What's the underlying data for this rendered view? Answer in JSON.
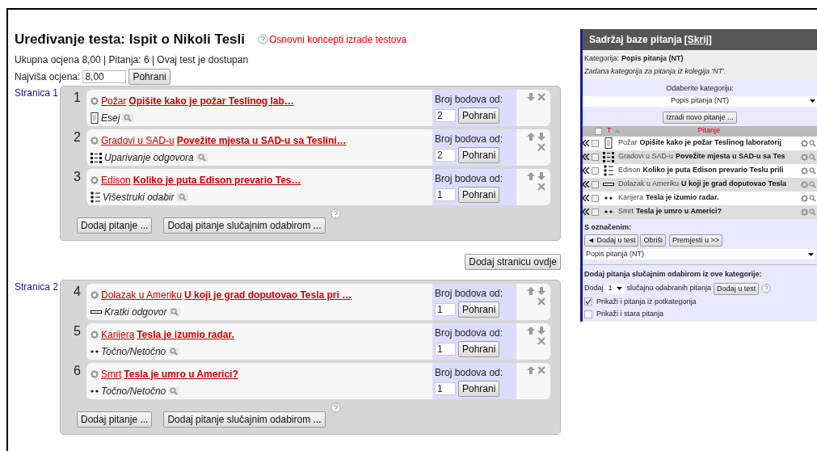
{
  "title": "Uređivanje testa: Ispit o Nikoli Tesli",
  "help_link": "Osnovni koncepti izrade testova",
  "summary": "Ukupna ocjena 8,00 | Pitanja: 6 | Ovaj test je dostupan",
  "max_grade": {
    "label": "Najviša ocjena:",
    "value": "8,00",
    "button": "Pohrani"
  },
  "pages": [
    {
      "label": "Stranica 1",
      "questions": [
        {
          "number": "1",
          "kind": "essay",
          "category": "Požar",
          "text": "Opišite kako je požar Teslinog lab…",
          "type_label": "Esej",
          "points_label": "Broj bodova od:",
          "points": "2",
          "save": "Pohrani",
          "can_move_up": false,
          "can_move_down": true
        },
        {
          "number": "2",
          "kind": "matching",
          "category": "Gradovi u SAD-u",
          "text": "Povežite mjesta u SAD-u sa Teslini…",
          "type_label": "Uparivanje odgovora",
          "points_label": "Broj bodova od:",
          "points": "2",
          "save": "Pohrani",
          "can_move_up": true,
          "can_move_down": true
        },
        {
          "number": "3",
          "kind": "multichoice",
          "category": "Edison",
          "text": "Koliko je puta Edison prevario Tes…",
          "type_label": "Višestruki odabir",
          "points_label": "Broj bodova od:",
          "points": "1",
          "save": "Pohrani",
          "can_move_up": true,
          "can_move_down": true
        }
      ],
      "add_question": "Dodaj pitanje ...",
      "add_random": "Dodaj pitanje slučajnim odabirom ..."
    },
    {
      "label": "Stranica 2",
      "questions": [
        {
          "number": "4",
          "kind": "shortanswer",
          "category": "Dolazak u Ameriku",
          "text": "U koji je grad doputovao Tesla pri …",
          "type_label": "Kratki odgovor",
          "points_label": "Broj bodova od:",
          "points": "1",
          "save": "Pohrani",
          "can_move_up": true,
          "can_move_down": true
        },
        {
          "number": "5",
          "kind": "truefalse",
          "category": "Karijera",
          "text": "Tesla je izumio radar.",
          "type_label": "Točno/Netočno",
          "points_label": "Broj bodova od:",
          "points": "1",
          "save": "Pohrani",
          "can_move_up": true,
          "can_move_down": true
        },
        {
          "number": "6",
          "kind": "truefalse",
          "category": "Smrt",
          "text": "Tesla je umro u Americi?",
          "type_label": "Točno/Netočno",
          "points_label": "Broj bodova od:",
          "points": "1",
          "save": "Pohrani",
          "can_move_up": true,
          "can_move_down": false
        }
      ],
      "add_question": "Dodaj pitanje ...",
      "add_random": "Dodaj pitanje slučajnim odabirom ..."
    }
  ],
  "add_page_button": "Dodaj stranicu ovdje",
  "bank": {
    "title": "Sadržaj baze pitanja",
    "hide_link": "[Skrij]",
    "category_label": "Kategorija:",
    "category": "Popis pitanja (NT)",
    "category_note": "Zadana kategorija za pitanja iz kolegija 'NT'.",
    "choose_label": "Odaberite kategoriju:",
    "choose_value": "Popis pitanja (NT)",
    "create_button": "Izradi novo pitanje ...",
    "columns": [
      "T",
      "Pitanje"
    ],
    "select_all_checked": false,
    "rows": [
      {
        "kind": "essay",
        "category": "Požar",
        "text": "Opišite kako je požar Teslinog laboratorij",
        "checked": false
      },
      {
        "kind": "matching",
        "category": "Gradovi u SAD-u",
        "text": "Povežite mjesta u SAD-u sa Tes",
        "checked": false
      },
      {
        "kind": "multichoice",
        "category": "Edison",
        "text": "Koliko je puta Edison prevario Teslu prili",
        "checked": false
      },
      {
        "kind": "shortanswer",
        "category": "Dolazak u Ameriku",
        "text": "U koji je grad doputovao Tesla",
        "checked": false
      },
      {
        "kind": "truefalse",
        "category": "Karijera",
        "text": "Tesla je izumio radar.",
        "checked": false
      },
      {
        "kind": "truefalse",
        "category": "Smrt",
        "text": "Tesla je umro u Americi?",
        "checked": false
      }
    ],
    "with_selected": "S označenim:",
    "add_to_test": "◄ Dodaj u test",
    "delete": "Obriši",
    "move_to": "Premjesti u >>",
    "move_target": "Popis pitanja (NT)",
    "random_title": "Dodaj pitanja slučajnim odabirom iz ove kategorije:",
    "random_prefix": "Dodaj",
    "random_count": "1",
    "random_suffix": "slučajno odabranih pitanja",
    "random_button": "Dodaj u test",
    "options": [
      {
        "label": "Prikaži i pitanja iz potkategorija",
        "checked": true
      },
      {
        "label": "Prikaži i stara pitanja",
        "checked": false
      }
    ]
  }
}
